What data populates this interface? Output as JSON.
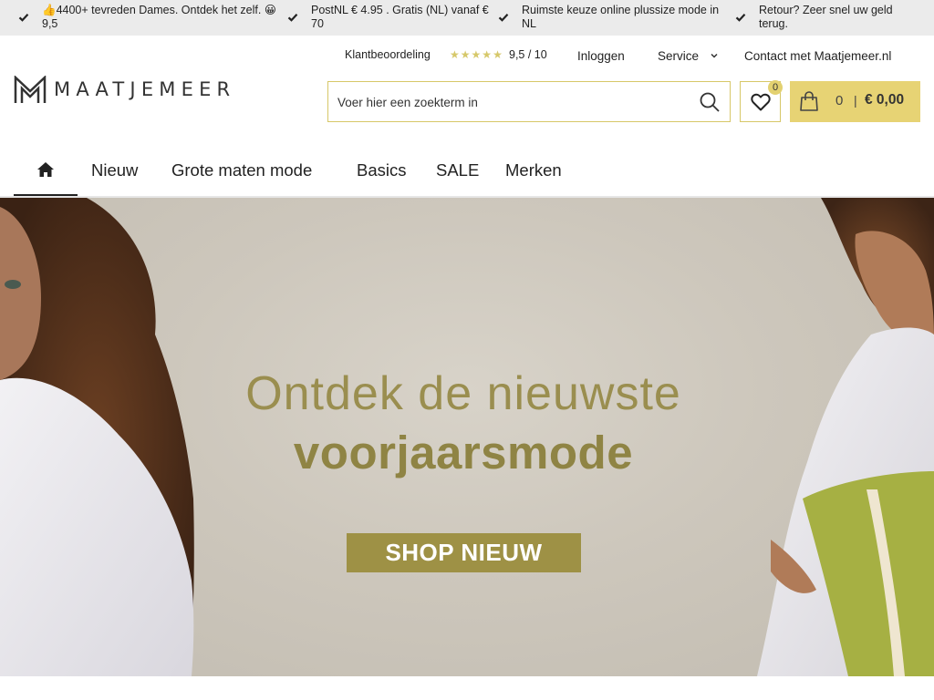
{
  "usp_bar": {
    "items": [
      {
        "text": "👍4400+ tevreden Dames. Ontdek het zelf. 😀 9,5",
        "icon": "check-icon"
      },
      {
        "text": "PostNL € 4.95 . Gratis (NL) vanaf € 70",
        "icon": "check-icon"
      },
      {
        "text": "Ruimste keuze online plussize mode in NL",
        "icon": "check-icon"
      },
      {
        "text": "Retour? Zeer snel uw geld terug.",
        "icon": "check-icon"
      }
    ]
  },
  "toplinks": {
    "rating_label": "Klantbeoordeling",
    "rating_stars": 5,
    "rating_value": "9,5 / 10",
    "login": "Inloggen",
    "service": "Service",
    "contact": "Contact met Maatjemeer.nl"
  },
  "logo": {
    "text": "MAATJEMEER"
  },
  "search": {
    "placeholder": "Voer hier een zoekterm in"
  },
  "wishlist": {
    "count": "0"
  },
  "cart": {
    "count": "0",
    "separator": "|",
    "total": "€ 0,00"
  },
  "nav": {
    "items": [
      {
        "label": "Nieuw"
      },
      {
        "label": "Grote maten mode"
      },
      {
        "label": "Basics"
      },
      {
        "label": "SALE"
      },
      {
        "label": "Merken"
      }
    ]
  },
  "hero": {
    "line1": "Ontdek de nieuwste",
    "line2": "voorjaarsmode",
    "cta": "SHOP NIEUW"
  },
  "colors": {
    "accent": "#e7d374",
    "brand_olive": "#9e9145",
    "usp_bg": "#ebebeb"
  }
}
